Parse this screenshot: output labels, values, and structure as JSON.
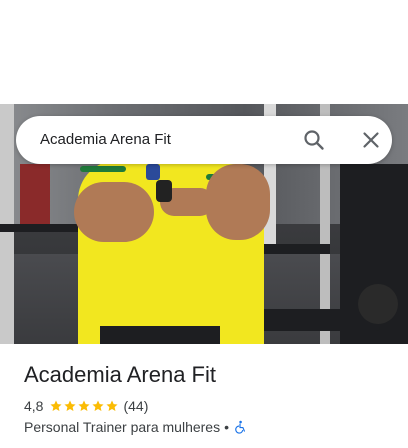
{
  "search": {
    "query": "Academia Arena Fit"
  },
  "icons": {
    "search": "search-icon",
    "close": "close-icon",
    "star": "star-icon",
    "accessible": "wheelchair-accessible-icon"
  },
  "colors": {
    "star": "#fbbc04",
    "accessible": "#1a73e8",
    "text_primary": "#202124",
    "text_secondary": "#3c4043"
  },
  "place": {
    "name": "Academia Arena Fit",
    "rating": "4,8",
    "rating_stars": 4.8,
    "reviews": "(44)",
    "category": "Personal Trainer para mulheres",
    "separator": "•"
  }
}
